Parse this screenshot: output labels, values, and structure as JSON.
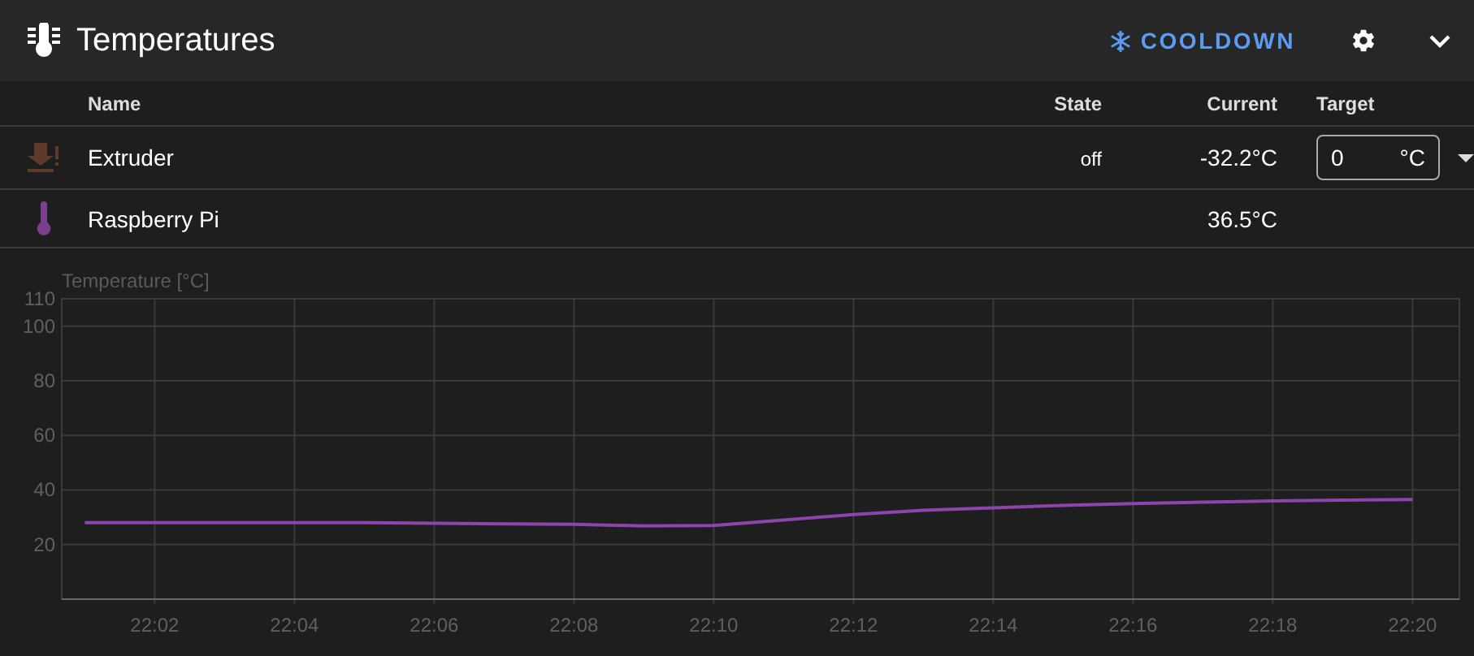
{
  "header": {
    "title": "Temperatures",
    "cooldown_label": "COOLDOWN"
  },
  "table": {
    "columns": [
      "Name",
      "State",
      "Current",
      "Target"
    ],
    "rows": [
      {
        "kind": "heater",
        "name": "Extruder",
        "color": "#5e3a2c",
        "state": "off",
        "current": "-32.2°C",
        "target": {
          "value": "0",
          "unit": "°C"
        }
      },
      {
        "kind": "sensor",
        "name": "Raspberry Pi",
        "color": "#7a3f8e",
        "current": "36.5°C"
      }
    ]
  },
  "chart": {
    "chart_data": {
      "type": "line",
      "ylabel": "Temperature [°C]",
      "grid": true,
      "ylim": [
        0,
        110
      ],
      "yticks": [
        20,
        40,
        60,
        80,
        100,
        110
      ],
      "categories": [
        null,
        "22:02",
        null,
        "22:04",
        null,
        "22:06",
        null,
        "22:08",
        null,
        "22:10",
        null,
        "22:12",
        null,
        "22:14",
        null,
        "22:16",
        null,
        "22:18",
        null,
        "22:20"
      ],
      "series": [
        {
          "color": "#8e44ad",
          "values": [
            28,
            28,
            28,
            28,
            28,
            27.8,
            27.6,
            27.4,
            26.8,
            27,
            29,
            31,
            32.5,
            33.5,
            34.3,
            35,
            35.5,
            36,
            36.3,
            36.5
          ]
        }
      ]
    }
  }
}
